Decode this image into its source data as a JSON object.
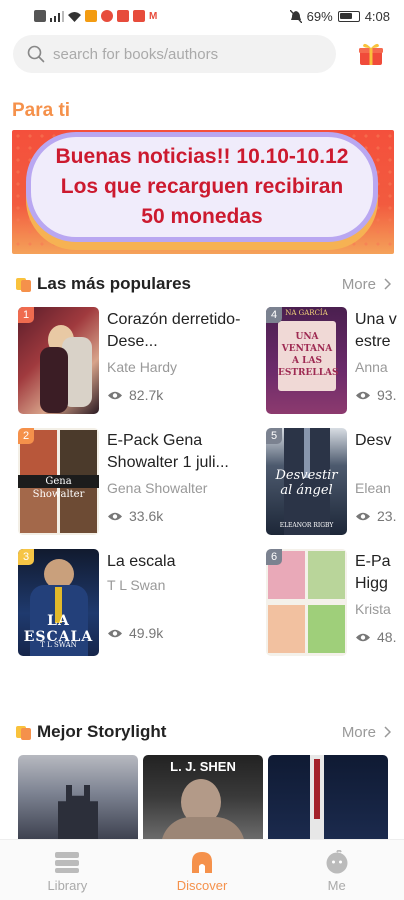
{
  "status_bar": {
    "battery": "69%",
    "time": "4:08"
  },
  "search": {
    "placeholder": "search for books/authors"
  },
  "para_ti": {
    "title": "Para ti",
    "banner_lines": [
      "Buenas noticias!! 10.10-10.12",
      "Los que recarguen recibiran",
      "50 monedas"
    ]
  },
  "populares": {
    "title": "Las más populares",
    "more": "More",
    "books": [
      {
        "rank": "1",
        "title": "Corazón derretido-Dese...",
        "author": "Kate Hardy",
        "views": "82.7k"
      },
      {
        "rank": "2",
        "title": "E-Pack Gena Showalter 1 juli...",
        "author": "Gena Showalter",
        "views": "33.6k"
      },
      {
        "rank": "3",
        "title": "La escala",
        "author": "T L Swan",
        "views": "49.9k"
      },
      {
        "rank": "4",
        "title": "Una v estre",
        "author": "Anna",
        "views": "93."
      },
      {
        "rank": "5",
        "title": "Desv",
        "author": "Elean",
        "views": "23."
      },
      {
        "rank": "6",
        "title": "E-Pa Higg",
        "author": "Krista",
        "views": "48."
      }
    ],
    "cover_texts": {
      "b4_top": "NA GARCÍA",
      "b4_mid": "UNA VENTANA A LAS ESTRELLAS",
      "b2_label": "Gena Showalter",
      "b3_main": "LA ESCALA",
      "b3_author": "T L SWAN",
      "b5_main": "Desvestir al ángel",
      "b5_author": "ELEANOR RIGBY"
    }
  },
  "storylight": {
    "title": "Mejor Storylight",
    "more": "More",
    "cover2_text": "L. J. SHEN"
  },
  "nav": {
    "library": "Library",
    "discover": "Discover",
    "me": "Me"
  }
}
